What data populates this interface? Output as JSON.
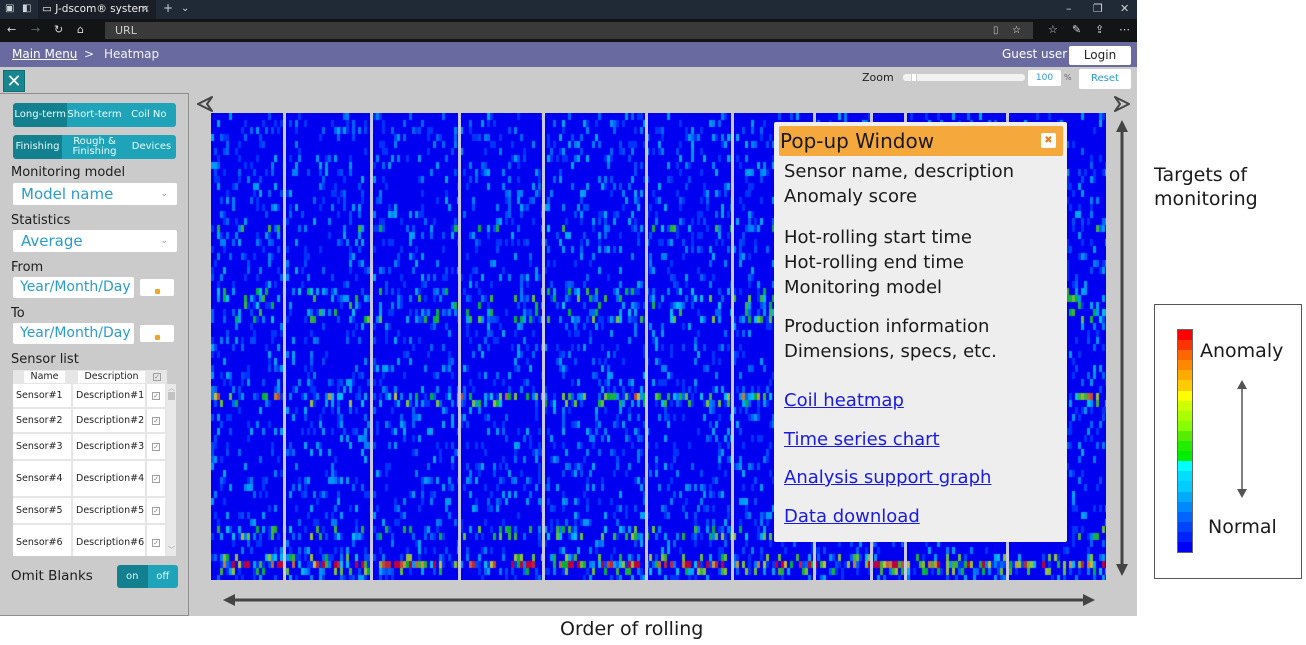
{
  "browser": {
    "tab_title": "J-dscom® system",
    "url": "URL"
  },
  "header": {
    "breadcrumb_root": "Main Menu",
    "breadcrumb_sep": ">",
    "breadcrumb_current": "Heatmap",
    "user": "Guest user",
    "login_label": "Login"
  },
  "sidebar": {
    "period_tabs": [
      {
        "label": "Long-term",
        "active": true
      },
      {
        "label": "Short-term",
        "active": false
      },
      {
        "label": "Coil No",
        "active": false
      }
    ],
    "section_tabs": [
      {
        "label": "Finishing",
        "active": true
      },
      {
        "label": "Rough & Finishing",
        "active": false
      },
      {
        "label": "Devices",
        "active": false
      }
    ],
    "monitoring_model_label": "Monitoring model",
    "monitoring_model_value": "Model name",
    "statistics_label": "Statistics",
    "statistics_value": "Average",
    "from_label": "From",
    "from_placeholder": "Year/Month/Day",
    "to_label": "To",
    "to_placeholder": "Year/Month/Day",
    "sensor_list_label": "Sensor list",
    "sensor_table": {
      "headers": [
        "Name",
        "Description"
      ],
      "rows": [
        {
          "name": "Sensor#1",
          "description": "Description#1",
          "checked": true
        },
        {
          "name": "Sensor#2",
          "description": "Description#2",
          "checked": true
        },
        {
          "name": "Sensor#3",
          "description": "Description#3",
          "checked": true
        },
        {
          "name": "Sensor#4",
          "description": "Description#4",
          "checked": true
        },
        {
          "name": "Sensor#5",
          "description": "Description#5",
          "checked": true
        },
        {
          "name": "Sensor#6",
          "description": "Description#6",
          "checked": true
        }
      ]
    },
    "omit_blanks_label": "Omit Blanks",
    "omit_on": "on",
    "omit_off": "off",
    "omit_value": "on"
  },
  "zoom": {
    "label": "Zoom",
    "value": "100",
    "unit": "%",
    "reset_label": "Reset"
  },
  "popup": {
    "title": "Pop-up Window",
    "lines_group1": [
      "Sensor name, description",
      "Anomaly score"
    ],
    "lines_group2": [
      "Hot-rolling start time",
      "Hot-rolling end time",
      "Monitoring model"
    ],
    "lines_group3": [
      "Production information",
      "Dimensions, specs, etc."
    ],
    "links": [
      "Coil heatmap",
      "Time series chart",
      "Analysis support graph",
      "Data download"
    ]
  },
  "annotations": {
    "x_axis": "Order of rolling",
    "y_axis_line1": "Targets of",
    "y_axis_line2": "monitoring",
    "legend_high": "Anomaly",
    "legend_low": "Normal"
  },
  "colors": {
    "accent": "#1fa3b8",
    "accent_active": "#13808f",
    "header": "#696aa0",
    "popup_title": "#f5a93c",
    "link": "#1a1ae6",
    "colorscale": [
      "#ff0000",
      "#ff3300",
      "#ff6600",
      "#ff8800",
      "#ffaa00",
      "#ffcc00",
      "#ffff00",
      "#ccff00",
      "#aaff00",
      "#88ff00",
      "#55ee00",
      "#22ee00",
      "#00ee00",
      "#00ffff",
      "#00ddff",
      "#00ccff",
      "#00aaff",
      "#0088ff",
      "#0066ff",
      "#0044ff",
      "#0022ff",
      "#0000ff"
    ]
  }
}
